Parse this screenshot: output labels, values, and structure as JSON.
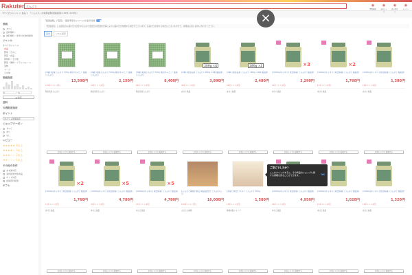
{
  "header": {
    "logo": "Rakuten",
    "search_value": "とんぶり",
    "genre_label": "指定",
    "icons": [
      {
        "name": "browse-history-icon",
        "label": "閲覧履歴"
      },
      {
        "name": "favorite-icon",
        "label": "お気に入り"
      },
      {
        "name": "cart-icon",
        "label": "買い物かご"
      },
      {
        "name": "member-icon",
        "label": "メンバー"
      }
    ]
  },
  "breadcrumb": "すべてのジャンル ＞ 食品 ＞ 「とんぶり」の検索結果(関連度順/1-45件 (215件))",
  "sidebar": {
    "genre_h": "価格",
    "opts1": [
      "すべて",
      "送料無料",
      "送料無料・条件付き送料無料"
    ],
    "jenre_h": "ジャンル",
    "genres": [
      "すべてのジャンル",
      "食品",
      "野菜・きのこ",
      "惣菜・食品",
      "調味料・その他",
      "野菜・果物・ドライフルーツ",
      "漬物",
      "スープ",
      "その他"
    ],
    "price_h": "価格指定",
    "price_from": "0",
    "price_to": "0",
    "price_btn": "▲ 指定",
    "ship_h": "送料",
    "delivery_h": "今週配送指定",
    "point_h": "ポイント",
    "select_val": "ポイント倍率指定",
    "coupon_h": "ショップクーポン",
    "opts2": [
      "すべて",
      "あり",
      "なし"
    ],
    "rating_h": "レビュー",
    "ratings": [
      "★★★★★ 4以上",
      "★★★★☆ 3以上",
      "★★★☆☆ 2以上",
      "★★☆☆☆ 1以上"
    ],
    "other_h": "その他の条件",
    "others": [
      "あす楽対応",
      "海外配送対象商品",
      "ギフト対応",
      "最強翌日配送"
    ],
    "gift_h": "ギフト"
  },
  "main": {
    "banner_text": "「配送最短」(「翌日」・配送予定のイメージ)の表示切替",
    "notice": "「配送最短」とは最短のお届け日を表示するもので配送日の配送状況等によりお届け日が前後する場合がございます。お届け日が遅れる場合もございますので、詳細はお店にお問い合わせください。",
    "tabs": [
      "画像",
      "リスト表示"
    ]
  },
  "products": [
    {
      "kind": "bag",
      "title": "[4袋] 乾燥とんぶり 500g 畑のキャビア 国産 とんぶり",
      "price": "13,500円",
      "pt": "135ポイント(1倍)",
      "shop": "秋田県産とんぶり"
    },
    {
      "kind": "bag",
      "title": "[2袋] 乾燥とんぶり 500g 畑のキャビア 国産 とんぶり",
      "price": "2,150円",
      "pt": "21ポイント(1倍)",
      "shop": "秋田県産とんぶり"
    },
    {
      "kind": "bag",
      "title": "[3袋] 乾燥とんぶり 500g 畑のキャビア 国産 とんぶり",
      "price": "8,400円",
      "pt": "84ポイント(1倍)",
      "shop": "秋田県産とんぶり"
    },
    {
      "kind": "jar4",
      "title": "[4本] 秋田名産 とんぶり 280g ×4本 瓶詰め",
      "price": "3,890円",
      "pt": "38ポイント(1倍)",
      "shop": "あきた食品"
    },
    {
      "kind": "jar2",
      "title": "[2本] 秋田名産 とんぶり 280g ×2本 瓶詰め",
      "price": "2,480円",
      "pt": "24ポイント(1倍)",
      "shop": "あきた食品"
    },
    {
      "kind": "jar3",
      "title": "[1000円ポッキリ] 秋田県産 とんぶり 瓶詰め",
      "price": "3,290円",
      "pt": "32ポイント(1倍)",
      "shop": "あきた食品"
    },
    {
      "kind": "jar2b",
      "title": "[1000円ポッキリ] 秋田県産 とんぶり 瓶詰め",
      "price": "1,760円",
      "pt": "17ポイント(1倍)",
      "shop": "あきた食品"
    },
    {
      "kind": "jar",
      "title": "[1000円ポッキリ] 秋田県産 とんぶり 瓶詰め",
      "price": "1,380円",
      "pt": "13ポイント(1倍)",
      "shop": "あきた食品"
    },
    {
      "kind": "jar2b",
      "title": "[1000円ポッキリ] 秋田県産 とんぶり 瓶詰め",
      "price": "1,760円",
      "pt": "17ポイント(1倍)",
      "shop": "あきた食品"
    },
    {
      "kind": "jar5",
      "title": "[1000円ポッキリ] 秋田県産 とんぶり 瓶詰め",
      "price": "4,780円",
      "pt": "47ポイント(1倍)",
      "shop": "あきた食品"
    },
    {
      "kind": "jar5",
      "title": "[1000円ポッキリ] 秋田県産 とんぶり 瓶詰め",
      "price": "4,780円",
      "pt": "47ポイント(1倍)",
      "shop": "あきた食品"
    },
    {
      "kind": "shot",
      "title": "[ふるさと納税] 桃山 納豆詰合せ とんぶり入り",
      "price": "16,000円",
      "pt": "160ポイント(1倍)",
      "shop": "ふるさと納税"
    },
    {
      "kind": "shot2",
      "title": "[お取り寄せ] キヌア とんぶり 300g",
      "price": "1,580円",
      "pt": "15ポイント(1倍)",
      "shop": "健康食品ショップ"
    },
    {
      "kind": "jar4b",
      "title": "[1000円ポッキリ] 秋田県産 とんぶり 瓶詰め",
      "price": "4,950円",
      "pt": "49ポイント(1倍)",
      "shop": "あきた食品"
    },
    {
      "kind": "jar",
      "title": "[1000円ポッキリ] 秋田県産 とんぶり 瓶詰め",
      "price": "1,020円",
      "pt": "10ポイント(1倍)",
      "shop": "あきた食品"
    },
    {
      "kind": "jar",
      "title": "[1000円ポッキリ] 秋田県産 とんぶり 瓶詰め",
      "price": "1,320円",
      "pt": "13ポイント(1倍)",
      "shop": "あきた食品"
    }
  ],
  "multipliers": {
    "jar3": "×3",
    "jar2b": "×2",
    "jar5": "×5",
    "jar4b": "×4"
  },
  "counts": {
    "jar4": "280g ×4",
    "jar2": "280g ×2"
  },
  "wish_label": "お気に入りに追加する",
  "tooltip": {
    "title": "ご存じでしたか?",
    "body": "ここをクリックすると、その商品のショップに関する詳細を見ることができます。",
    "ok": "OK"
  },
  "close_glyph": "×"
}
